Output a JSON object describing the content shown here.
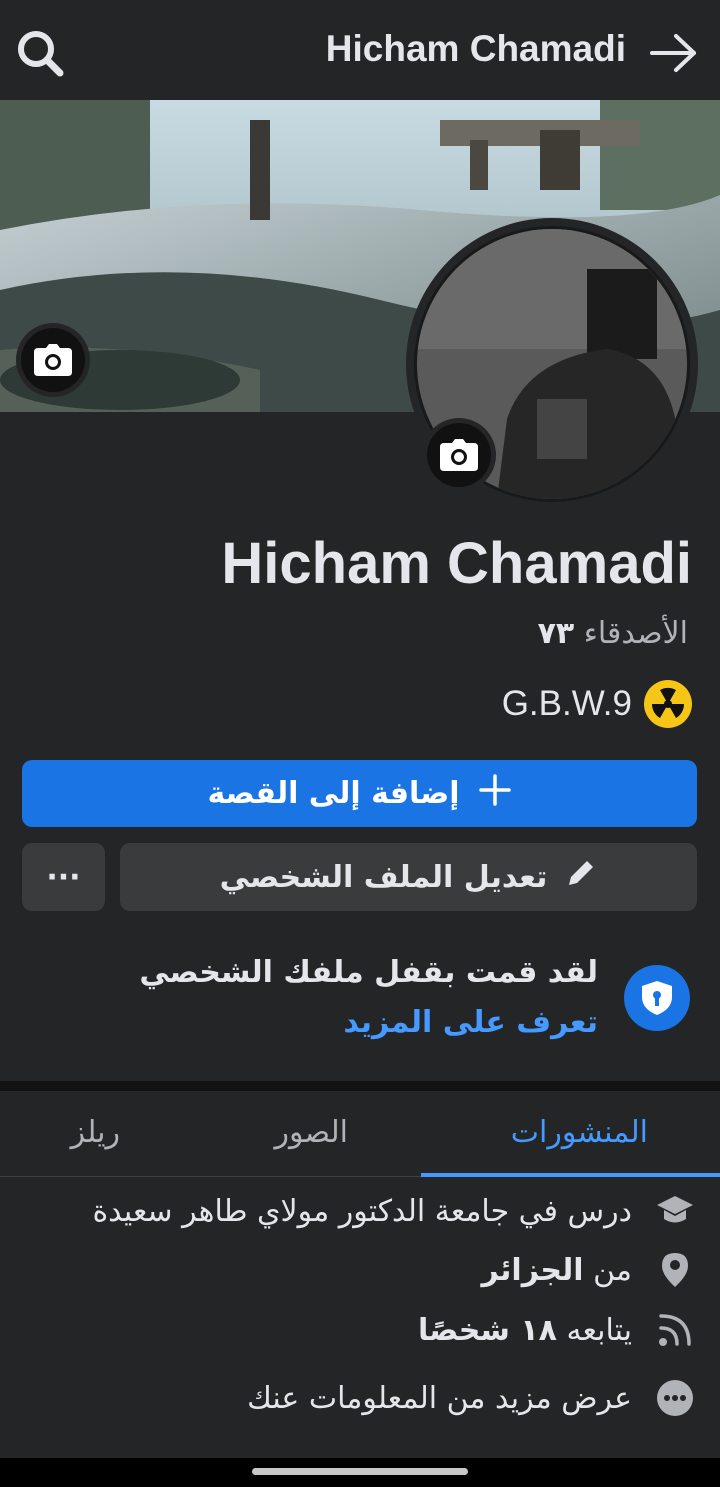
{
  "header": {
    "title": "Hicham Chamadi"
  },
  "profile": {
    "name": "Hicham Chamadi",
    "friends_label": "الأصدقاء",
    "friends_count": "٧٣",
    "bio": "G.B.W.9"
  },
  "actions": {
    "add_story": "إضافة إلى القصة",
    "edit_profile": "تعديل الملف الشخصي",
    "more": "···"
  },
  "lock_notice": {
    "title": "لقد قمت بقفل ملفك الشخصي",
    "link": "تعرف على المزيد"
  },
  "tabs": [
    {
      "label": "المنشورات",
      "active": true
    },
    {
      "label": "الصور",
      "active": false
    },
    {
      "label": "ريلز",
      "active": false
    }
  ],
  "intro": {
    "education": "درس في جامعة الدكتور مولاي طاهر سعيدة",
    "location_prefix": "من",
    "location": "الجزائر",
    "followers_prefix": "يتابعه",
    "followers": "١٨ شخصًا",
    "see_more": "عرض مزيد من المعلومات عنك"
  },
  "colors": {
    "accent": "#1b74e4",
    "link": "#4599ff",
    "background": "#242526",
    "button": "#3a3b3c"
  },
  "icons": [
    "search-icon",
    "arrow-right-icon",
    "camera-icon",
    "radioactive-icon",
    "plus-icon",
    "pencil-icon",
    "shield-lock-icon",
    "graduation-cap-icon",
    "location-pin-icon",
    "rss-icon",
    "more-dots-icon"
  ]
}
